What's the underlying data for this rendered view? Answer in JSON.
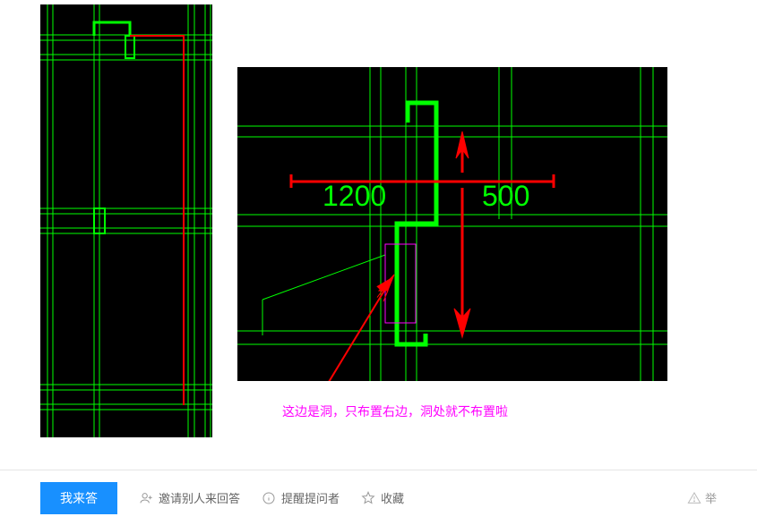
{
  "images": {
    "small": {
      "description": "CAD drawing left - vertical section with green structural lines and red highlight"
    },
    "large": {
      "description": "CAD drawing right - detail view with dimensions",
      "dimensions": {
        "left": "1200",
        "right": "500"
      }
    }
  },
  "annotation": "这边是洞，只布置右边，洞处就不布置啦",
  "actions": {
    "answer": "我来答",
    "invite": "邀请别人来回答",
    "remind": "提醒提问者",
    "favorite": "收藏",
    "report": "举"
  }
}
